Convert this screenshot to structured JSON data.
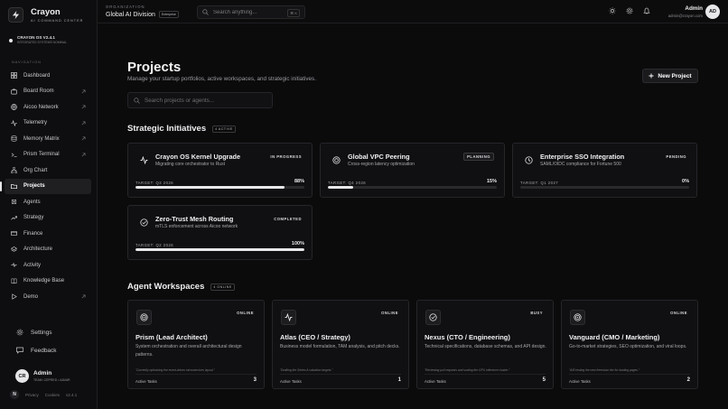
{
  "brand": {
    "name": "Crayon",
    "subtitle": "AI COMMAND CENTER"
  },
  "os_status": {
    "title": "CRAYON OS V2.4.1",
    "subtitle": "INTEGRATED SYSTEMS NOMINAL"
  },
  "sidebar": {
    "heading": "NAVIGATION",
    "items": [
      {
        "label": "Dashboard",
        "icon": "grid-icon",
        "external": false
      },
      {
        "label": "Board Room",
        "icon": "briefcase-icon",
        "external": true
      },
      {
        "label": "Aicoo Network",
        "icon": "globe-icon",
        "external": true
      },
      {
        "label": "Telemetry",
        "icon": "activity-icon",
        "external": true
      },
      {
        "label": "Memory Matrix",
        "icon": "database-icon",
        "external": true
      },
      {
        "label": "Prism Terminal",
        "icon": "terminal-icon",
        "external": true
      },
      {
        "label": "Org Chart",
        "icon": "org-chart-icon",
        "external": false
      },
      {
        "label": "Projects",
        "icon": "folder-icon",
        "external": false,
        "active": true
      },
      {
        "label": "Agents",
        "icon": "cpu-icon",
        "external": false
      },
      {
        "label": "Strategy",
        "icon": "trending-icon",
        "external": false
      },
      {
        "label": "Finance",
        "icon": "wallet-icon",
        "external": false
      },
      {
        "label": "Architecture",
        "icon": "layers-icon",
        "external": false
      },
      {
        "label": "Activity",
        "icon": "pulse-icon",
        "external": false
      },
      {
        "label": "Knowledge Base",
        "icon": "book-icon",
        "external": false
      },
      {
        "label": "Demo",
        "icon": "play-icon",
        "external": true
      }
    ],
    "settings_label": "Settings",
    "feedback_label": "Feedback"
  },
  "user": {
    "initials": "CR",
    "name": "Admin",
    "role": "TEAM: CEPRED • AAVAR"
  },
  "footer": {
    "badge": "N",
    "privacy": "Privacy",
    "cookies": "Cookies",
    "version": "v2.4.1"
  },
  "topbar": {
    "org_label": "ORGANIZATION",
    "org_name": "Global AI Division",
    "org_badge": "Enterprise",
    "search_placeholder": "Search anything...",
    "search_shortcut": "⌘ K",
    "admin_name": "Admin",
    "admin_email": "admin@crayon.com",
    "admin_initials": "AD"
  },
  "page": {
    "title": "Projects",
    "subtitle": "Manage your startup portfolios, active workspaces, and strategic initiatives.",
    "new_button": "New Project",
    "search_placeholder": "Search projects or agents..."
  },
  "initiatives": {
    "title": "Strategic Initiatives",
    "badge": "4 ACTIVE",
    "items": [
      {
        "title": "Crayon OS Kernel Upgrade",
        "desc": "Migrating core orchestrator to Rust",
        "status": "IN PROGRESS",
        "target": "TARGET: Q3 2026",
        "progress": 88,
        "progress_label": "88%"
      },
      {
        "title": "Global VPC Peering",
        "desc": "Cross-region latency optimization",
        "status": "PLANNING",
        "target": "TARGET: Q4 2026",
        "progress": 15,
        "progress_label": "15%"
      },
      {
        "title": "Enterprise SSO Integration",
        "desc": "SAML/OIDC compliance for Fortune 500",
        "status": "PENDING",
        "target": "TARGET: Q1 2027",
        "progress": 0,
        "progress_label": "0%"
      },
      {
        "title": "Zero-Trust Mesh Routing",
        "desc": "mTLS enforcement across Aicoo network",
        "status": "COMPLETED",
        "target": "TARGET: Q2 2026",
        "progress": 100,
        "progress_label": "100%"
      }
    ]
  },
  "workspaces": {
    "title": "Agent Workspaces",
    "badge": "4 ONLINE",
    "items": [
      {
        "title": "Prism (Lead Architect)",
        "desc": "System orchestration and overall architectural design patterns.",
        "status": "ONLINE",
        "quote": "\"Currently optimizing the event-driven microservices layout.\"",
        "tasks_label": "Active Tasks",
        "tasks": "3",
        "icon": "target-icon"
      },
      {
        "title": "Atlas (CEO / Strategy)",
        "desc": "Business model formulation, TAM analysis, and pitch decks.",
        "status": "ONLINE",
        "quote": "\"Drafting the Series A valuation targets.\"",
        "tasks_label": "Active Tasks",
        "tasks": "1",
        "icon": "activity-icon"
      },
      {
        "title": "Nexus (CTO / Engineering)",
        "desc": "Technical specifications, database schemas, and API design.",
        "status": "BUSY",
        "quote": "\"Reviewing pull requests and scaling the GPU inference cluster.\"",
        "tasks_label": "Active Tasks",
        "tasks": "5",
        "icon": "check-circle-icon"
      },
      {
        "title": "Vanguard (CMO / Marketing)",
        "desc": "Go-to-market strategies, SEO optimization, and viral loops.",
        "status": "ONLINE",
        "quote": "\"A/B testing the new freemium tier for landing pages.\"",
        "tasks_label": "Active Tasks",
        "tasks": "2",
        "icon": "target-icon"
      }
    ]
  },
  "colors": {
    "background": "#0b0b0c",
    "surface": "#101012",
    "border": "#26262a",
    "accent": "#e8e8ea"
  }
}
